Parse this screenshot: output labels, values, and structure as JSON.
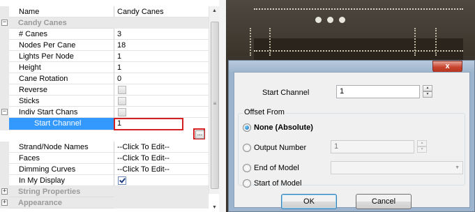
{
  "property_grid": {
    "header": {
      "name": "Name",
      "value": "Candy Canes"
    },
    "category_candy_canes": {
      "toggle": "−",
      "label": "Candy Canes"
    },
    "rows": [
      {
        "name": "# Canes",
        "value": "3"
      },
      {
        "name": "Nodes Per Cane",
        "value": "18"
      },
      {
        "name": "Lights Per Node",
        "value": "1"
      },
      {
        "name": "Height",
        "value": "1"
      },
      {
        "name": "Cane Rotation",
        "value": "0"
      }
    ],
    "reverse": {
      "name": "Reverse",
      "checked": false
    },
    "sticks": {
      "name": "Sticks",
      "checked": false
    },
    "indiv_start_chans": {
      "toggle": "−",
      "name": "Indiv Start Chans",
      "checked": false
    },
    "start_channel": {
      "name": "Start Channel",
      "value": "1",
      "button": "..."
    },
    "strand_node_names": {
      "name": "Strand/Node Names",
      "value": "--Click To Edit--"
    },
    "faces": {
      "name": "Faces",
      "value": "--Click To Edit--"
    },
    "dimming_curves": {
      "name": "Dimming Curves",
      "value": "--Click To Edit--"
    },
    "in_my_display": {
      "name": "In My Display",
      "checked": true
    },
    "category_string_properties": {
      "toggle": "+",
      "label": "String Properties"
    },
    "category_appearance": {
      "toggle": "+",
      "label": "Appearance"
    },
    "scrollbar": {
      "up": "▲",
      "down": "▼"
    }
  },
  "dialog": {
    "close_label": "x",
    "start_channel_label": "Start Channel",
    "start_channel_value": "1",
    "offset_from_label": "Offset From",
    "options": {
      "none_absolute": "None (Absolute)",
      "output_number": "Output Number",
      "end_of_model": "End of Model",
      "start_of_model": "Start of Model"
    },
    "selected_option": "none_absolute",
    "output_number_value": "1",
    "spin_up": "▲",
    "spin_down": "▼",
    "combo_arrow": "▼",
    "ok_label": "OK",
    "cancel_label": "Cancel"
  }
}
